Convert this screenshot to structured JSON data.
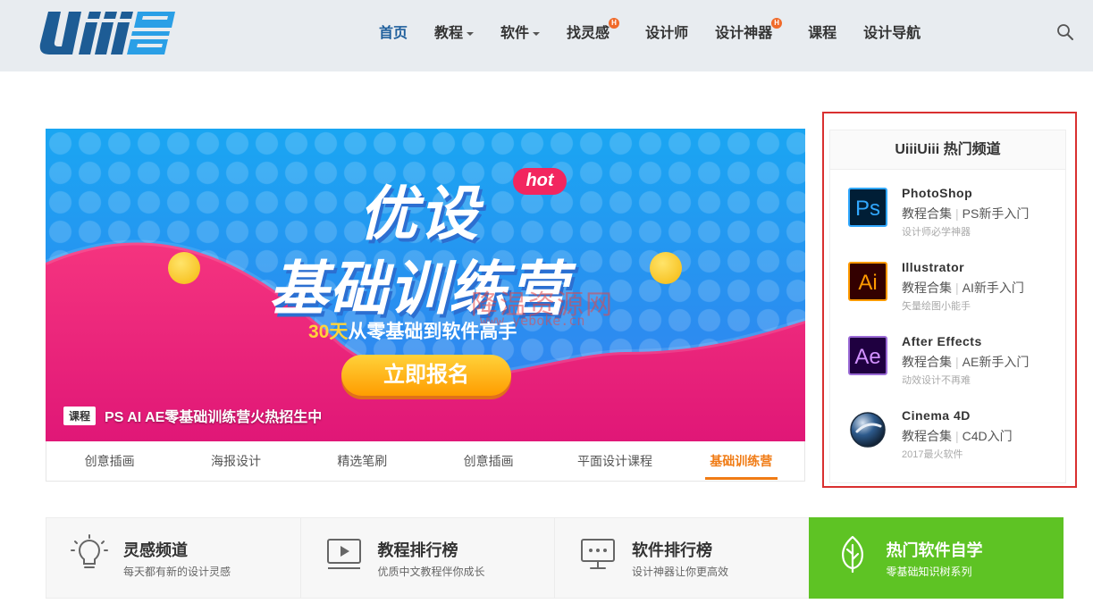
{
  "header": {
    "logo_text": "Uiiiuiii",
    "nav": [
      {
        "label": "首页",
        "active": true
      },
      {
        "label": "教程",
        "dropdown": true
      },
      {
        "label": "软件",
        "dropdown": true
      },
      {
        "label": "找灵感",
        "hot": true
      },
      {
        "label": "设计师"
      },
      {
        "label": "设计神器",
        "hot": true
      },
      {
        "label": "课程"
      },
      {
        "label": "设计导航"
      }
    ],
    "hot_mark": "H"
  },
  "banner": {
    "title_line1": "优设",
    "title_line2": "基础训练营",
    "hot_tag": "hot",
    "subtitle_highlight": "30天",
    "subtitle_rest": "从零基础到软件高手",
    "cta": "立即报名",
    "badge": "课程",
    "caption": "PS AI AE零基础训练营火热招生中",
    "watermark": "降温资源网",
    "watermark_url": "www.yeboke.cn"
  },
  "banner_tabs": [
    "创意插画",
    "海报设计",
    "精选笔刷",
    "创意插画",
    "平面设计课程",
    "基础训练营"
  ],
  "sidebar": {
    "title": "UiiiUiii 热门频道",
    "items": [
      {
        "name": "PhotoShop",
        "icon": "Ps",
        "link1": "教程合集",
        "link2": "PS新手入门",
        "desc": "设计师必学神器",
        "color": "#31a8ff",
        "bg": "#001e36"
      },
      {
        "name": "Illustrator",
        "icon": "Ai",
        "link1": "教程合集",
        "link2": "AI新手入门",
        "desc": "矢量绘图小能手",
        "color": "#ff9a00",
        "bg": "#330000"
      },
      {
        "name": "After Effects",
        "icon": "Ae",
        "link1": "教程合集",
        "link2": "AE新手入门",
        "desc": "动效设计不再难",
        "color": "#d291ff",
        "bg": "#1f0040"
      },
      {
        "name": "Cinema 4D",
        "icon": "c4d-sphere-icon",
        "link1": "教程合集",
        "link2": "C4D入门",
        "desc": "2017最火软件"
      }
    ]
  },
  "features": [
    {
      "title": "灵感频道",
      "sub": "每天都有新的设计灵感",
      "icon": "lightbulb-icon"
    },
    {
      "title": "教程排行榜",
      "sub": "优质中文教程伴你成长",
      "icon": "video-play-icon"
    },
    {
      "title": "软件排行榜",
      "sub": "设计神器让你更高效",
      "icon": "monitor-icon"
    },
    {
      "title": "热门软件自学",
      "sub": "零基础知识树系列",
      "icon": "leaf-icon"
    }
  ],
  "colors": {
    "accent": "#1f5f9c",
    "orange": "#f07b14",
    "green": "#5ec324",
    "red_box": "#d93030"
  }
}
